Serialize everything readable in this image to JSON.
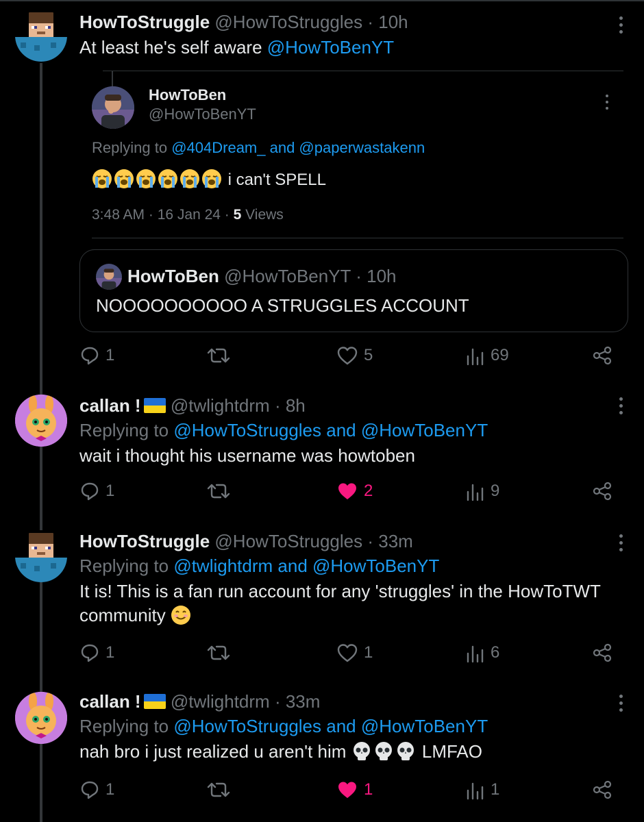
{
  "tweets": [
    {
      "name": "HowToStruggle",
      "handle": "@HowToStruggles",
      "sep": "·",
      "time": "10h",
      "text": "At least he's self aware",
      "mention": "@HowToBenYT",
      "avatar": "pixel-character-avatar",
      "actions": {
        "replies": "1",
        "retweets": "",
        "likes": "5",
        "views": "69"
      }
    },
    {
      "name": "callan !",
      "flag": "ukraine-flag",
      "handle": "@twlightdrm",
      "sep": "·",
      "time": "8h",
      "replying_prefix": "Replying to",
      "replying_to": "@HowToStruggles and @HowToBenYT",
      "text": "wait i thought his username was howtoben",
      "avatar": "cartoon-bunny-avatar",
      "actions": {
        "replies": "1",
        "retweets": "",
        "likes": "2",
        "views": "9",
        "liked": true
      }
    },
    {
      "name": "HowToStruggle",
      "handle": "@HowToStruggles",
      "sep": "·",
      "time": "33m",
      "replying_prefix": "Replying to",
      "replying_to": "@twlightdrm and @HowToBenYT",
      "text_line1": "It is! This is a fan run account for any 'struggles' in the HowToTWT",
      "text_line2": "community",
      "emoji": "smiling-face-emoji",
      "avatar": "pixel-character-avatar",
      "actions": {
        "replies": "1",
        "retweets": "",
        "likes": "1",
        "views": "6"
      }
    },
    {
      "name": "callan !",
      "flag": "ukraine-flag",
      "handle": "@twlightdrm",
      "sep": "·",
      "time": "33m",
      "replying_prefix": "Replying to",
      "replying_to": "@HowToStruggles and @HowToBenYT",
      "text": "nah bro i just realized u aren't him",
      "text_end": "LMFAO",
      "emoji": "skull-emoji",
      "avatar": "cartoon-bunny-avatar",
      "actions": {
        "replies": "1",
        "retweets": "",
        "likes": "1",
        "views": "1",
        "liked": true
      }
    }
  ],
  "embedded": {
    "name": "HowToBen",
    "handle": "@HowToBenYT",
    "replying_prefix": "Replying to",
    "replying_to": "@404Dream_ and @paperwastakenn",
    "emoji": "loudly-crying-face-emoji",
    "emoji_count": 6,
    "text": "i can't SPELL",
    "timestamp": "3:48 AM · 16 Jan 24 · ",
    "views_count": "5",
    "views_label": "Views"
  },
  "quote": {
    "name": "HowToBen",
    "handle": "@HowToBenYT",
    "sep": "·",
    "time": "10h",
    "text": "NOOOOOOOOOO A STRUGGLES ACCOUNT"
  },
  "colors": {
    "background": "#000000",
    "link": "#1d9bf0",
    "muted": "#71767b",
    "like": "#f91880"
  }
}
